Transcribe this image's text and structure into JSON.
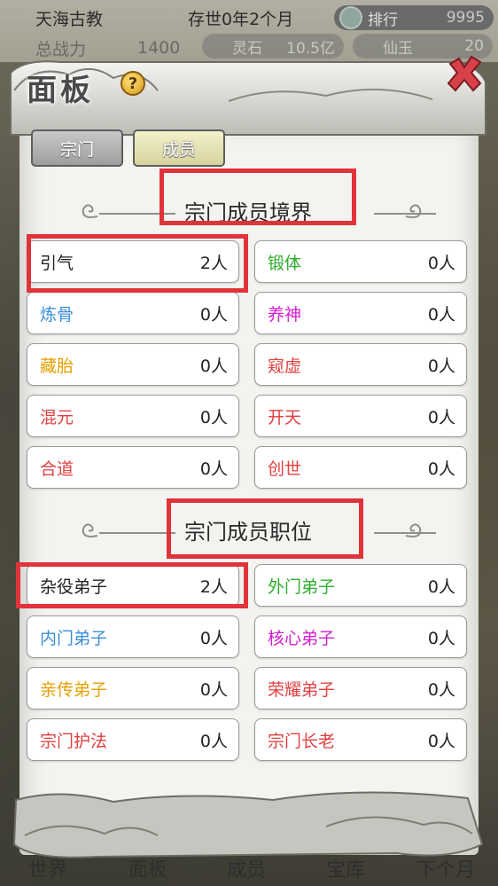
{
  "top": {
    "sect_name": "天海古教",
    "time_text": "存世0年2个月",
    "rank_label": "排行",
    "rank_value": "9995",
    "power_label": "总战力",
    "power_value": "1400",
    "stone_label": "灵石",
    "stone_value": "10.5亿",
    "jade_label": "仙玉",
    "jade_value": "20"
  },
  "panel": {
    "title": "面板",
    "help": "?",
    "tabs": [
      {
        "label": "宗门",
        "active": false
      },
      {
        "label": "成员",
        "active": true
      }
    ],
    "realm_section_title": "宗门成员境界",
    "position_section_title": "宗门成员职位",
    "realms": [
      {
        "label": "引气",
        "count": "2人",
        "color": "#222222"
      },
      {
        "label": "锻体",
        "count": "0人",
        "color": "#2cae2c"
      },
      {
        "label": "炼骨",
        "count": "0人",
        "color": "#3a8fd6"
      },
      {
        "label": "养神",
        "count": "0人",
        "color": "#d21fd2"
      },
      {
        "label": "藏胎",
        "count": "0人",
        "color": "#e6a000"
      },
      {
        "label": "窥虚",
        "count": "0人",
        "color": "#e04040"
      },
      {
        "label": "混元",
        "count": "0人",
        "color": "#e04040"
      },
      {
        "label": "开天",
        "count": "0人",
        "color": "#e04040"
      },
      {
        "label": "合道",
        "count": "0人",
        "color": "#e04040"
      },
      {
        "label": "创世",
        "count": "0人",
        "color": "#e04040"
      }
    ],
    "positions": [
      {
        "label": "杂役弟子",
        "count": "2人",
        "color": "#222222"
      },
      {
        "label": "外门弟子",
        "count": "0人",
        "color": "#2cae2c"
      },
      {
        "label": "内门弟子",
        "count": "0人",
        "color": "#3a8fd6"
      },
      {
        "label": "核心弟子",
        "count": "0人",
        "color": "#d21fd2"
      },
      {
        "label": "亲传弟子",
        "count": "0人",
        "color": "#e6a000"
      },
      {
        "label": "荣耀弟子",
        "count": "0人",
        "color": "#e04040"
      },
      {
        "label": "宗门护法",
        "count": "0人",
        "color": "#e04040"
      },
      {
        "label": "宗门长老",
        "count": "0人",
        "color": "#e04040"
      }
    ]
  },
  "bottom_nav": {
    "world": "世界",
    "panel": "面板",
    "members": "成员",
    "treasury": "宝库",
    "next_month": "下个月"
  }
}
